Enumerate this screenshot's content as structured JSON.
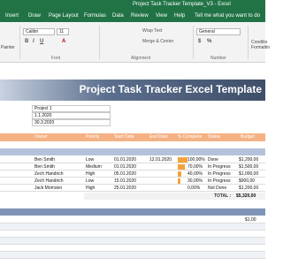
{
  "window": {
    "title": "Project Task Tracker Template_V3 - Excel"
  },
  "ribbon_tabs": [
    "Insert",
    "Draw",
    "Page Layout",
    "Formulas",
    "Data",
    "Review",
    "View",
    "Help",
    "Tell me what you want to do"
  ],
  "ribbon": {
    "font_name": "Calibri",
    "font_size": "11",
    "wrap_text": "Wrap Text",
    "merge_center": "Merge & Center",
    "number_format": "General",
    "painter": "Painter",
    "group_font": "Font",
    "group_alignment": "Alignment",
    "group_number": "Number",
    "conditional": "Conditio",
    "formatting": "Formattin",
    "bold": "B",
    "italic": "I",
    "underline": "U",
    "font_color_glyph": "A",
    "currency_glyph": "$",
    "percent_glyph": "%"
  },
  "sheet": {
    "banner_title": "Project Task Tracker Excel Template",
    "info": [
      "Project 1",
      "1.1.2020",
      "30.3.2020"
    ],
    "columns": [
      "Owner",
      "Priority",
      "Start Date",
      "End Date",
      "% Complete",
      "Status",
      "Budget"
    ],
    "tasks": [
      {
        "owner": "Ben Smith",
        "priority": "Low",
        "start": "01.01.2020",
        "end": "12.01.2020",
        "pct": "100,00%",
        "pct_value": 100,
        "status": "Done",
        "budget": "$1,200,00"
      },
      {
        "owner": "Ben Smith",
        "priority": "Medium",
        "start": "01.01.2020",
        "end": "",
        "pct": "70,00%",
        "pct_value": 70,
        "status": "In Progress",
        "budget": "$1,500,00"
      },
      {
        "owner": "Zech Handrich",
        "priority": "High",
        "start": "05.01.2020",
        "end": "",
        "pct": "40,00%",
        "pct_value": 40,
        "status": "In Progress",
        "budget": "$1,000,00"
      },
      {
        "owner": "Zech Handrich",
        "priority": "Low",
        "start": "15.01.2020",
        "end": "",
        "pct": "30,00%",
        "pct_value": 30,
        "status": "In Progress",
        "budget": "$900,00"
      },
      {
        "owner": "Jack Morrsion",
        "priority": "High",
        "start": "25.01.2020",
        "end": "",
        "pct": "0,00%",
        "pct_value": 0,
        "status": "Not Done",
        "budget": "$1,200,00"
      }
    ],
    "total_label": "TOTAL :",
    "total_value": "$5,320,00",
    "lower_value": "$1,00",
    "colors": {
      "banner": "#4f6182",
      "header": "#f4b183",
      "progress": "#f6a23a",
      "section_blue": "#b4c3da",
      "excel_green": "#217346"
    }
  }
}
